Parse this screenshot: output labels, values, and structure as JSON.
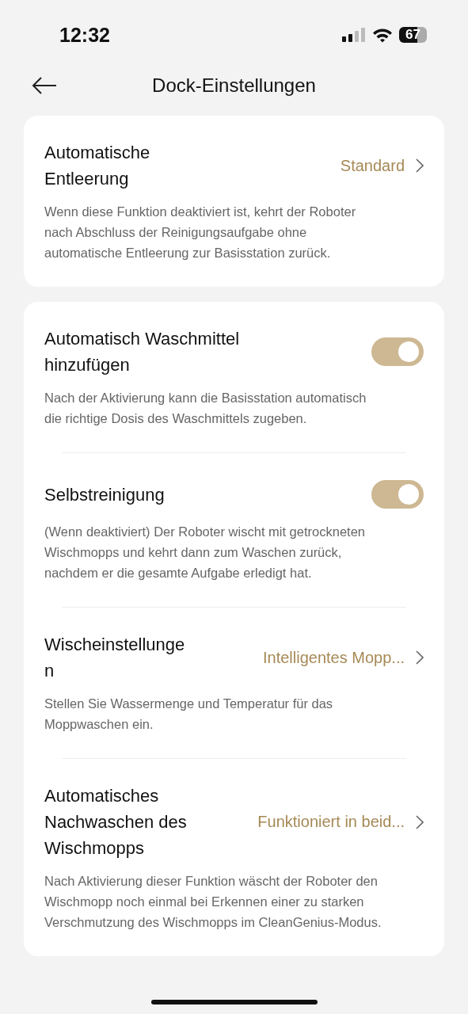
{
  "status_bar": {
    "time": "12:32",
    "battery": "67"
  },
  "header": {
    "title": "Dock-Einstellungen"
  },
  "cards": [
    {
      "rows": [
        {
          "kind": "select",
          "title": "Automatische Entleerung",
          "value": "Standard",
          "description": "Wenn diese Funktion deaktiviert ist, kehrt der Roboter nach Abschluss der Reinigungsaufgabe ohne automatische Entleerung zur Basisstation zurück."
        }
      ]
    },
    {
      "rows": [
        {
          "kind": "toggle",
          "title": "Automatisch Waschmittel hinzufügen",
          "on": true,
          "description": "Nach der Aktivierung kann die Basisstation automatisch die richtige Dosis des Waschmittels zugeben."
        },
        {
          "kind": "toggle",
          "title": "Selbstreinigung",
          "on": true,
          "description": "(Wenn deaktiviert) Der Roboter wischt mit getrockneten Wischmopps und kehrt dann zum Waschen zurück, nachdem er die gesamte Aufgabe erledigt hat."
        },
        {
          "kind": "select",
          "title": "Wischeinstellungen",
          "value": "Intelligentes Mopp...",
          "description": "Stellen Sie Wassermenge und Temperatur für das Moppwaschen ein."
        },
        {
          "kind": "select",
          "title": "Automatisches Nachwaschen des Wischmopps",
          "value": "Funktioniert in beid...",
          "description": "Nach Aktivierung dieser Funktion wäscht der Roboter den Wischmopp noch einmal bei Erkennen einer zu starken Verschmutzung des Wischmopps im CleanGenius-Modus."
        }
      ]
    }
  ]
}
